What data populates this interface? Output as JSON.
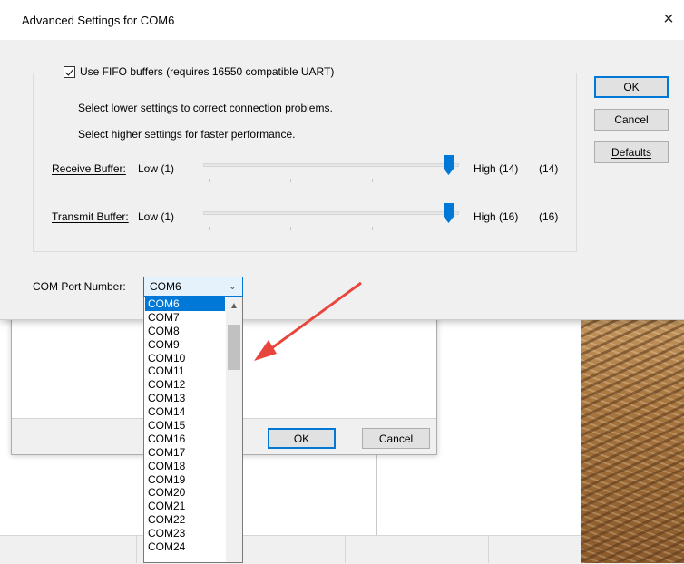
{
  "dialog": {
    "title": "Advanced Settings for COM6",
    "close_glyph": "×",
    "fifo_label": "Use FIFO buffers (requires 16550 compatible UART)",
    "fifo_checked": true,
    "hint1": "Select lower settings to correct connection problems.",
    "hint2": "Select higher settings for faster performance.",
    "receive": {
      "label": "Receive Buffer:",
      "low": "Low (1)",
      "high": "High (14)",
      "value": "(14)",
      "level": 1.0
    },
    "transmit": {
      "label": "Transmit Buffer:",
      "low": "Low (1)",
      "high": "High (16)",
      "value": "(16)",
      "level": 1.0
    },
    "buttons": {
      "ok": "OK",
      "cancel": "Cancel",
      "defaults": "Defaults"
    },
    "com_port": {
      "label": "COM Port Number:",
      "selected": "COM6",
      "options": [
        "COM6",
        "COM7",
        "COM8",
        "COM9",
        "COM10",
        "COM11",
        "COM12",
        "COM13",
        "COM14",
        "COM15",
        "COM16",
        "COM17",
        "COM18",
        "COM19",
        "COM20",
        "COM21",
        "COM22",
        "COM23",
        "COM24"
      ]
    }
  },
  "behind_dialog": {
    "ok": "OK",
    "cancel": "Cancel"
  },
  "colors": {
    "accent": "#0078d7",
    "arrow": "#e8463c"
  }
}
